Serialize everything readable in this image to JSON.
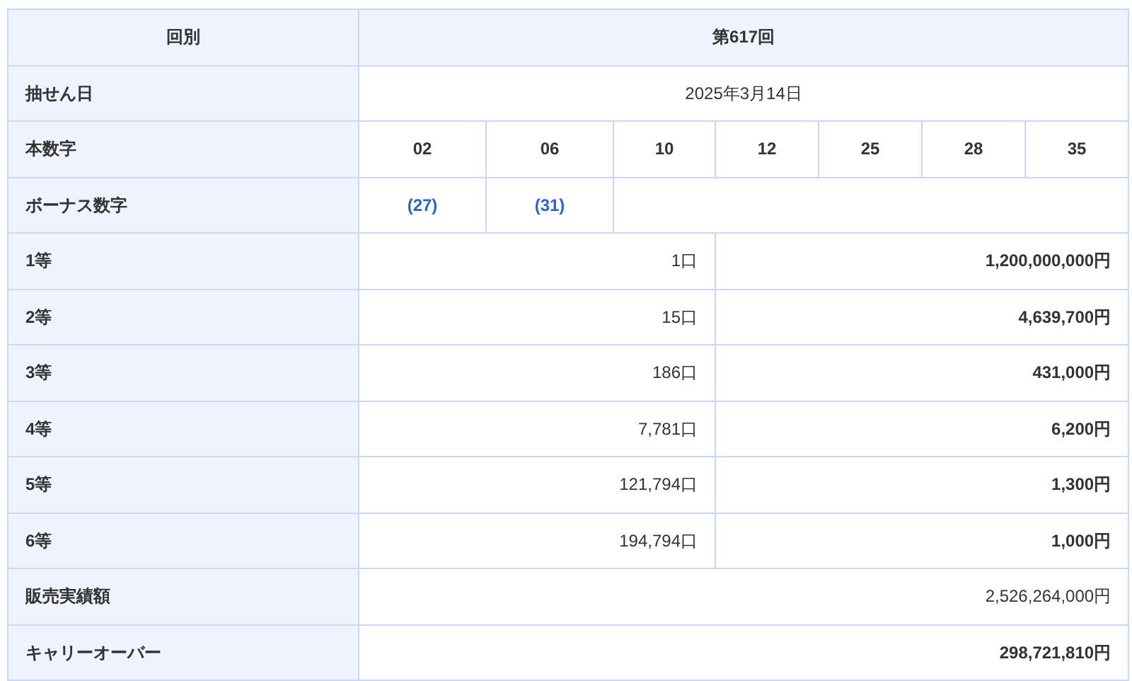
{
  "header": {
    "label": "回別",
    "value": "第617回"
  },
  "draw_date": {
    "label": "抽せん日",
    "value": "2025年3月14日"
  },
  "main_numbers": {
    "label": "本数字",
    "numbers": [
      "02",
      "06",
      "10",
      "12",
      "25",
      "28",
      "35"
    ]
  },
  "bonus_numbers": {
    "label": "ボーナス数字",
    "numbers": [
      "(27)",
      "(31)"
    ]
  },
  "prizes": [
    {
      "label": "1等",
      "winners": "1口",
      "amount": "1,200,000,000円"
    },
    {
      "label": "2等",
      "winners": "15口",
      "amount": "4,639,700円"
    },
    {
      "label": "3等",
      "winners": "186口",
      "amount": "431,000円"
    },
    {
      "label": "4等",
      "winners": "7,781口",
      "amount": "6,200円"
    },
    {
      "label": "5等",
      "winners": "121,794口",
      "amount": "1,300円"
    },
    {
      "label": "6等",
      "winners": "194,794口",
      "amount": "1,000円"
    }
  ],
  "sales": {
    "label": "販売実績額",
    "value": "2,526,264,000円"
  },
  "carryover": {
    "label": "キャリーオーバー",
    "value": "298,721,810円"
  }
}
